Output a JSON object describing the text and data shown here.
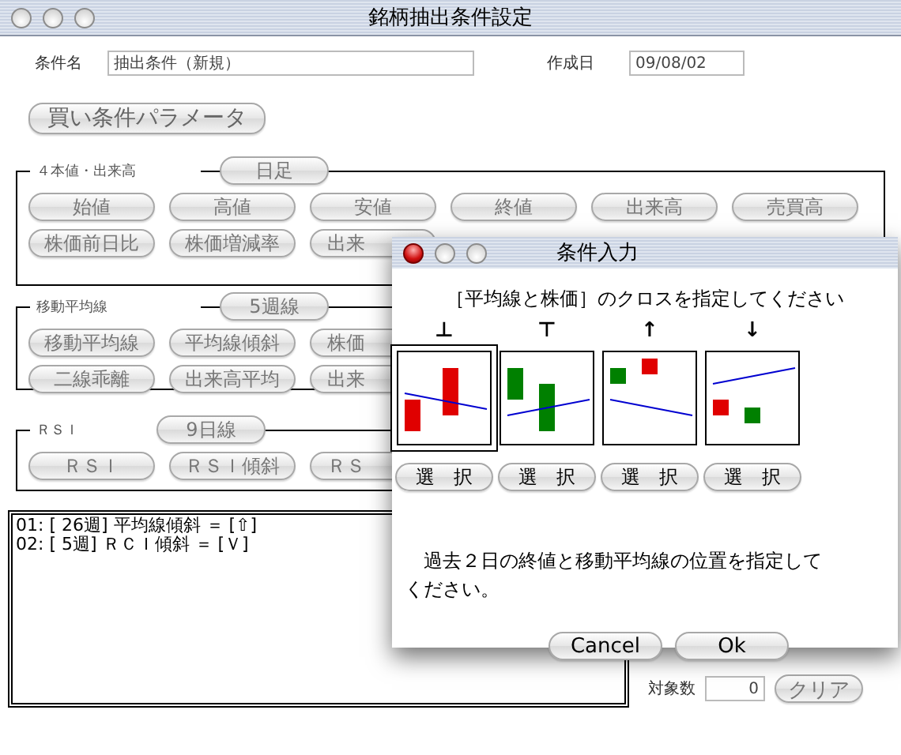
{
  "window": {
    "title": "銘柄抽出条件設定"
  },
  "form": {
    "name_label": "条件名",
    "name_value": "抽出条件（新規）",
    "date_label": "作成日",
    "date_value": "09/08/02"
  },
  "param_button": "買い条件パラメータ",
  "groups": [
    {
      "label": "４本値・出来高",
      "header_button": "日足",
      "rows": [
        [
          "始値",
          "高値",
          "安値",
          "終値",
          "出来高",
          "売買高"
        ],
        [
          "株価前日比",
          "株価増減率",
          "出来"
        ]
      ]
    },
    {
      "label": "移動平均線",
      "header_button": "5週線",
      "rows": [
        [
          "移動平均線",
          "平均線傾斜",
          "株価"
        ],
        [
          "二線乖離",
          "出来高平均",
          "出来"
        ]
      ]
    },
    {
      "label": "ＲＳＩ",
      "header_button": "9日線",
      "rows": [
        [
          "ＲＳＩ",
          "ＲＳＩ傾斜",
          "ＲＳ"
        ]
      ]
    }
  ],
  "log": [
    "01: [ 26週] 平均線傾斜 ＝ [⇧]",
    "02: [ 5週] ＲＣＩ傾斜 ＝ [Ｖ]"
  ],
  "count": {
    "label": "対象数",
    "value": "0",
    "clear_button": "クリア"
  },
  "dialog": {
    "title": "条件入力",
    "prompt": "［平均線と株価］のクロスを指定してください",
    "options": [
      {
        "symbol": "⊥",
        "kind": "cross-up",
        "selected": true,
        "button": "選　択"
      },
      {
        "symbol": "⊤",
        "kind": "cross-down",
        "selected": false,
        "button": "選　択"
      },
      {
        "symbol": "↑",
        "kind": "above",
        "selected": false,
        "button": "選　択"
      },
      {
        "symbol": "↓",
        "kind": "below",
        "selected": false,
        "button": "選　択"
      }
    ],
    "message": "　過去２日の終値と移動平均線の位置を指定してください。",
    "buttons": [
      "Cancel",
      "Ok"
    ]
  }
}
